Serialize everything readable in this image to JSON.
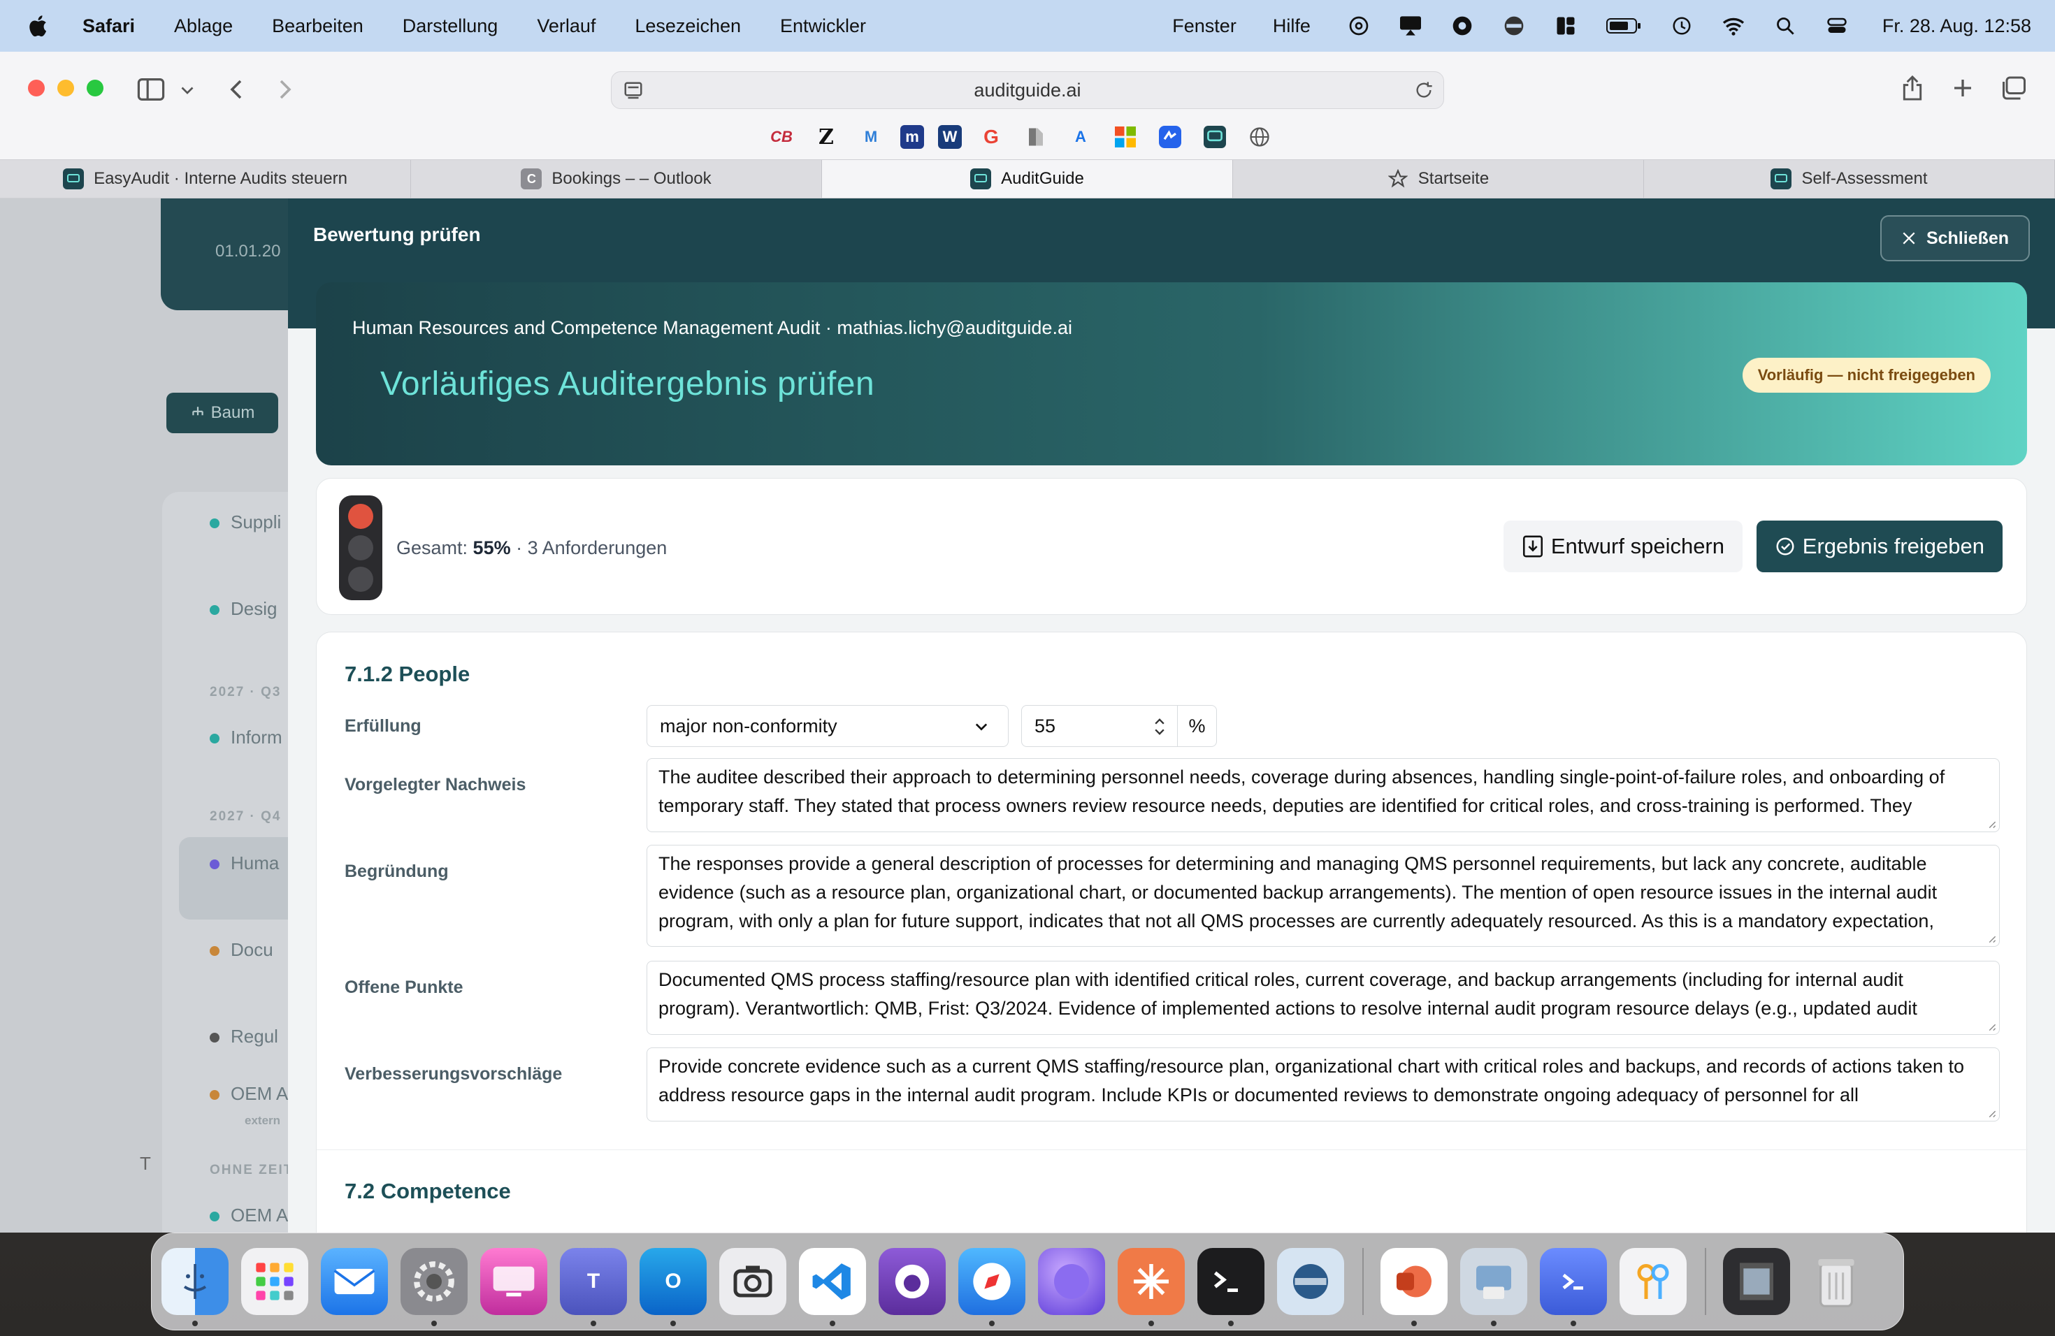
{
  "menubar": {
    "app": "Safari",
    "items": [
      "Ablage",
      "Bearbeiten",
      "Darstellung",
      "Verlauf",
      "Lesezeichen",
      "Entwickler"
    ],
    "right_items": [
      "Fenster",
      "Hilfe"
    ],
    "clock": "Fr. 28. Aug.  12:58"
  },
  "browser": {
    "url": "auditguide.ai",
    "tabs": [
      {
        "label": "EasyAudit · Interne Audits steuern",
        "icon": "chat-icon"
      },
      {
        "label": "Bookings – – Outlook",
        "icon": "c-icon"
      },
      {
        "label": "AuditGuide",
        "icon": "chat-icon",
        "active": true
      },
      {
        "label": "Startseite",
        "icon": "star-icon"
      },
      {
        "label": "Self-Assessment",
        "icon": "chat-icon"
      }
    ],
    "favorites": [
      "CB",
      "Z",
      "M",
      "m",
      "W",
      "G",
      "",
      "A",
      "",
      "",
      "",
      "",
      ""
    ]
  },
  "background": {
    "date": "01.01.20",
    "baum": "Baum",
    "items": [
      "Suppli",
      "Desig",
      "Inform",
      "Huma",
      "Docu",
      "Regul",
      "OEM A",
      "OEM A"
    ],
    "subheads": [
      "2027 · Q3",
      "2027 · Q4",
      "OHNE ZEIT"
    ],
    "tag": "extern",
    "bottom_letter": "T"
  },
  "modal": {
    "title": "Bewertung prüfen",
    "close_label": "Schließen",
    "meta": "Human Resources and Competence Management Audit · mathias.lichy@auditguide.ai",
    "heading": "Vorläufiges Auditergebnis prüfen",
    "badge": "Vorläufig — nicht freigegeben",
    "summary": {
      "prefix": "Gesamt:",
      "score": "55%",
      "suffix": "· 3 Anforderungen"
    },
    "save_label": "Entwurf speichern",
    "release_label": "Ergebnis freigeben",
    "section": {
      "title": "7.1.2 People",
      "labels": {
        "fulfillment": "Erfüllung",
        "evidence": "Vorgelegter Nachweis",
        "reasoning": "Begründung",
        "open_points": "Offene Punkte",
        "improvements": "Verbesserungsvorschläge"
      },
      "fulfillment_value": "major non-conformity",
      "percent_value": "55",
      "percent_unit": "%",
      "evidence_text": "The auditee described their approach to determining personnel needs, coverage during absences, handling single-point-of-failure roles, and onboarding of temporary staff. They stated that process owners review resource needs, deputies are identified for critical roles, and cross-training is performed. They",
      "reasoning_text": "The responses provide a general description of processes for determining and managing QMS personnel requirements, but lack any concrete, auditable evidence (such as a resource plan, organizational chart, or documented backup arrangements). The mention of open resource issues in the internal audit program, with only a plan for future support, indicates that not all QMS processes are currently adequately resourced. As this is a mandatory expectation,",
      "open_points_text": "Documented QMS process staffing/resource plan with identified critical roles, current coverage, and backup arrangements (including for internal audit program). Verantwortlich: QMB, Frist: Q3/2024. Evidence of implemented actions to resolve internal audit program resource delays (e.g., updated audit",
      "improvements_text": "Provide concrete evidence such as a current QMS staffing/resource plan, organizational chart with critical roles and backups, and records of actions taken to address resource gaps in the internal audit program. Include KPIs or documented reviews to demonstrate ongoing adequacy of personnel for all"
    },
    "next_section_title": "7.2 Competence"
  },
  "colors": {
    "teal_dark": "#1d454e",
    "teal_accent": "#6ee3d9",
    "badge_bg": "#fdf1c7",
    "traffic_red": "#e0533f"
  }
}
